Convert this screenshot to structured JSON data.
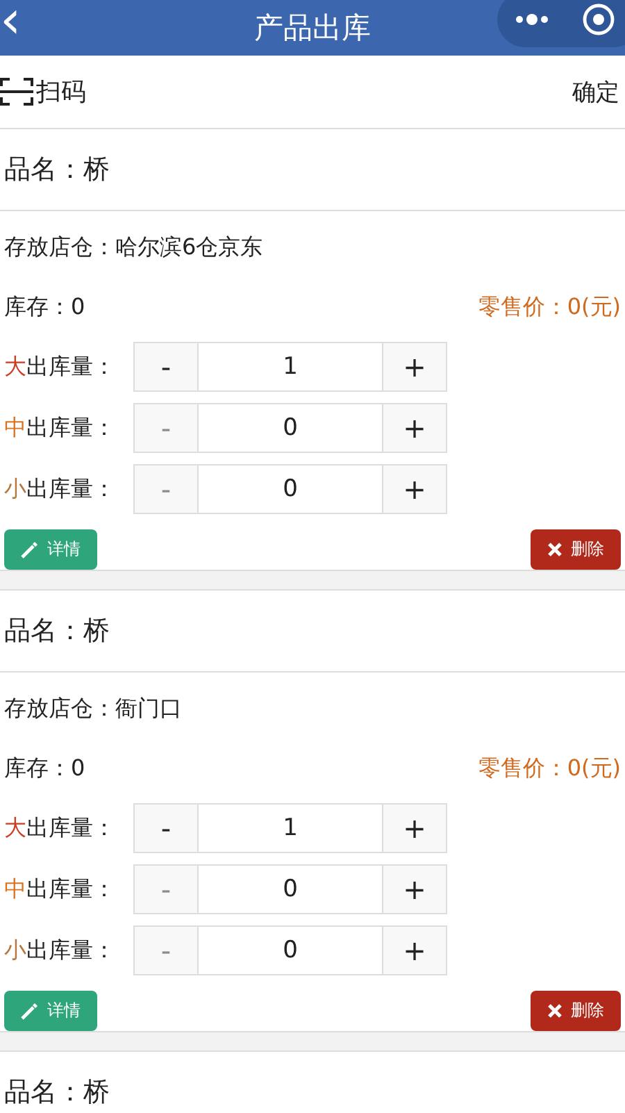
{
  "header": {
    "back": "‹",
    "title": "产品出库"
  },
  "toolbar": {
    "scan": "扫码",
    "confirm": "确定"
  },
  "items": [
    {
      "name_label": "品名：",
      "name": "桥",
      "store_label": "存放店仓：",
      "store": "哈尔滨6仓京东",
      "stock_label": "库存：",
      "stock": "0",
      "price_label": "零售价：",
      "price": "0(元)",
      "quantities": [
        {
          "prefix": "大",
          "color": "#cc3d22",
          "label": "出库量：",
          "minus": "-",
          "value": "1",
          "plus": "+",
          "minus_disabled": false
        },
        {
          "prefix": "中",
          "color": "#d9731f",
          "label": "出库量：",
          "minus": "-",
          "value": "0",
          "plus": "+",
          "minus_disabled": true
        },
        {
          "prefix": "小",
          "color": "#b5773f",
          "label": "出库量：",
          "minus": "-",
          "value": "0",
          "plus": "+",
          "minus_disabled": true
        }
      ],
      "detail_button": "详情",
      "delete_button": "删除"
    },
    {
      "name_label": "品名：",
      "name": "桥",
      "store_label": "存放店仓：",
      "store": "衙门口",
      "stock_label": "库存：",
      "stock": "0",
      "price_label": "零售价：",
      "price": "0(元)",
      "quantities": [
        {
          "prefix": "大",
          "color": "#cc3d22",
          "label": "出库量：",
          "minus": "-",
          "value": "1",
          "plus": "+",
          "minus_disabled": false
        },
        {
          "prefix": "中",
          "color": "#d9731f",
          "label": "出库量：",
          "minus": "-",
          "value": "0",
          "plus": "+",
          "minus_disabled": true
        },
        {
          "prefix": "小",
          "color": "#b5773f",
          "label": "出库量：",
          "minus": "-",
          "value": "0",
          "plus": "+",
          "minus_disabled": true
        }
      ],
      "detail_button": "详情",
      "delete_button": "删除"
    },
    {
      "name_label": "品名：",
      "name": "桥"
    }
  ]
}
